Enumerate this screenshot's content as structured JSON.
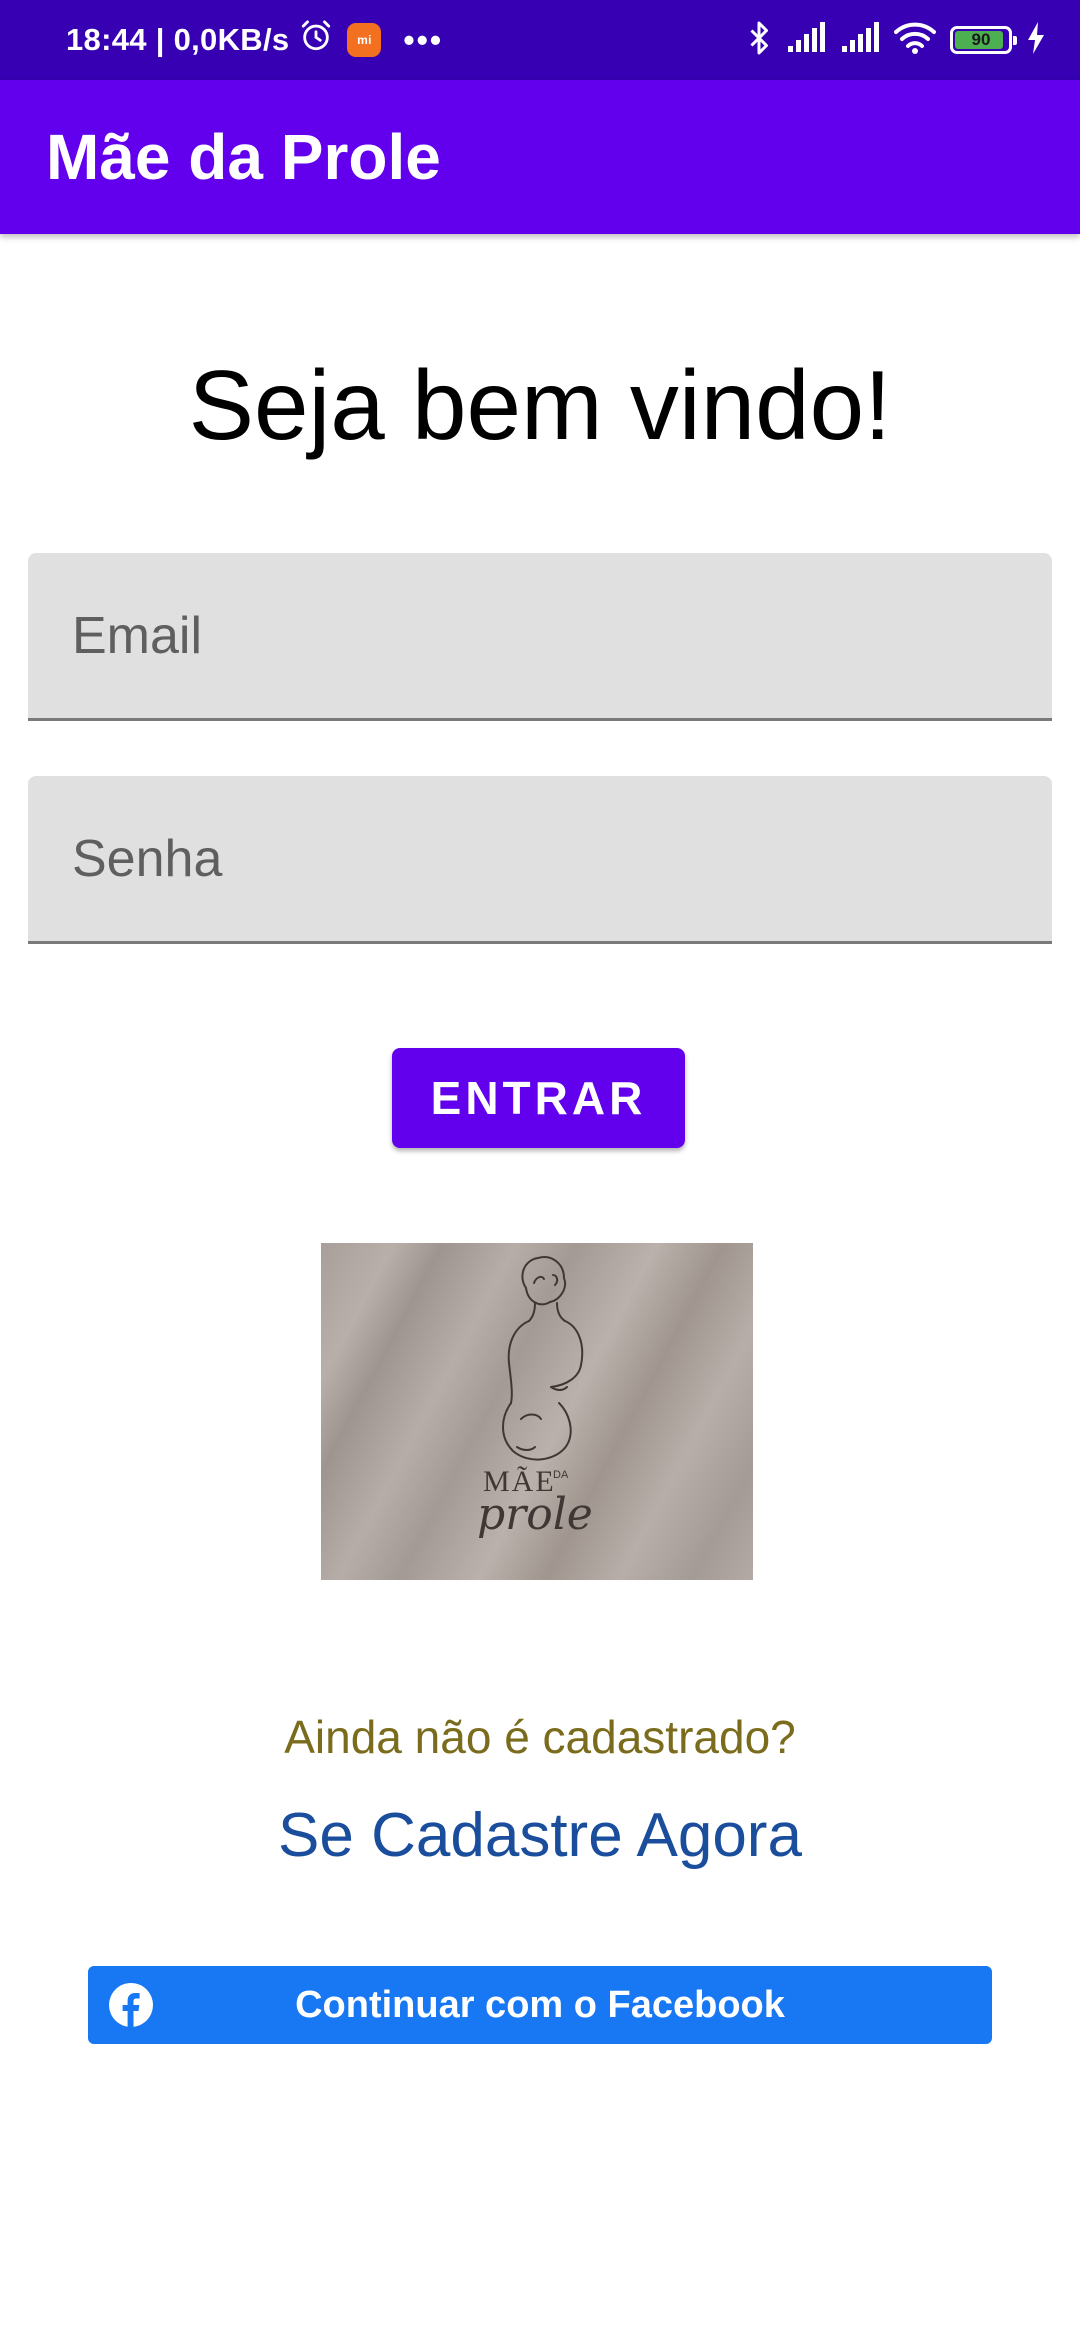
{
  "status_bar": {
    "time_speed": "18:44 | 0,0KB/s",
    "battery": "90",
    "icons": [
      "alarm-icon",
      "mi-app-icon",
      "more-dots-icon",
      "bluetooth-icon",
      "signal-icon",
      "signal-icon",
      "wifi-icon",
      "battery-icon",
      "charging-icon"
    ]
  },
  "app_bar": {
    "title": "Mãe da Prole"
  },
  "login": {
    "welcome": "Seja bem vindo!",
    "email_placeholder": "Email",
    "password_placeholder": "Senha",
    "submit_label": "ENTRAR"
  },
  "logo": {
    "wordmark_top": "MÃE",
    "wordmark_small": "DA",
    "wordmark_script": "prole"
  },
  "register": {
    "question": "Ainda não é cadastrado?",
    "link_label": "Se Cadastre Agora"
  },
  "facebook": {
    "label": "Continuar com o Facebook",
    "color": "#1877f2"
  },
  "colors": {
    "status_bar": "#3700b3",
    "primary": "#6200ee",
    "field_bg": "#e0e0e0",
    "question_text": "#7a6c1c",
    "link_text": "#1a4e9c"
  }
}
